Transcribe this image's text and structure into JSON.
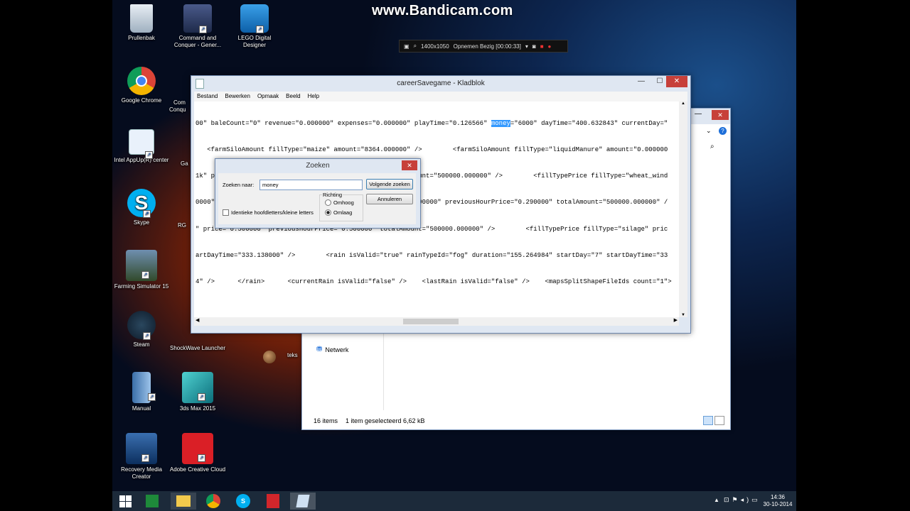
{
  "watermark": "www.Bandicam.com",
  "recorder": {
    "resolution": "1400x1050",
    "status": "Opnemen Bezig [00:00:33]"
  },
  "desktop_icons": {
    "recycle": "Prullenbak",
    "cnc": "Command and Conquer - Gener...",
    "lego": "LEGO Digital Designer",
    "chrome": "Google Chrome",
    "intel": "Intel AppUp(R) center",
    "skype": "Skype",
    "farming": "Farming Simulator 15",
    "steam": "Steam",
    "shockwave": "ShockWave Launcher",
    "manual": "Manual",
    "max": "3ds Max 2015",
    "recovery": "Recovery Media Creator",
    "adobe": "Adobe Creative Cloud",
    "partial_1": "Com Conqu",
    "partial_2": "Ga",
    "partial_3": "RG",
    "partial_4": "teks"
  },
  "notepad": {
    "title": "careerSavegame - Kladblok",
    "menu": [
      "Bestand",
      "Bewerken",
      "Opmaak",
      "Beeld",
      "Help"
    ],
    "lines": [
      {
        "pre": "00\" baleCount=\"0\" revenue=\"0.000000\" expenses=\"0.000000\" playTime=\"0.126566\" ",
        "hl": "money",
        "post": "=\"6000\" dayTime=\"400.632843\" currentDay=\""
      },
      {
        "pre": "   <farmSiloAmount fillType=\"maize\" amount=\"8364.000000\" />        <farmSiloAmount fillType=\"liquidManure\" amount=\"0.000000",
        "hl": "",
        "post": ""
      },
      {
        "pre": "1k\" price=\"0.400000\" previousHourPrice=\"0.400000\" totalAmount=\"500000.000000\" />        <fillTypePrice fillType=\"wheat_wind",
        "hl": "",
        "post": ""
      },
      {
        "pre": "0000\" />        <fillTypePrice fillType=\"wheat\" price=\"0.290000\" previousHourPrice=\"0.290000\" totalAmount=\"500000.000000\" /",
        "hl": "",
        "post": ""
      },
      {
        "pre": "\" price=\"0.500000\" previousHourPrice=\"0.500000\" totalAmount=\"500000.000000\" />        <fillTypePrice fillType=\"silage\" pric",
        "hl": "",
        "post": ""
      },
      {
        "pre": "artDayTime=\"333.138000\" />        <rain isValid=\"true\" rainTypeId=\"fog\" duration=\"155.264984\" startDay=\"7\" startDayTime=\"33",
        "hl": "",
        "post": ""
      },
      {
        "pre": "4\" />      </rain>      <currentRain isValid=\"false\" />    <lastRain isValid=\"false\" />    <mapsSplitShapeFileIds count=\"1\">",
        "hl": "",
        "post": ""
      }
    ]
  },
  "find_dialog": {
    "title": "Zoeken",
    "search_label": "Zoeken naar:",
    "search_value": "money",
    "find_next": "Volgende zoeken",
    "cancel": "Annuleren",
    "direction_label": "Richting",
    "up": "Omhoog",
    "down": "Omlaag",
    "match_case": "Identieke hoofdletters/kleine letters"
  },
  "explorer": {
    "nav_network": "Netwerk",
    "item_count": "16 items",
    "selection": "1 item geselecteerd  6,62 kB"
  },
  "taskbar": {
    "time": "14:36",
    "date": "30-10-2014"
  },
  "colors": {
    "selection": "#3399ff",
    "close_button": "#c7403a",
    "taskbar": "#1c2a3a"
  }
}
